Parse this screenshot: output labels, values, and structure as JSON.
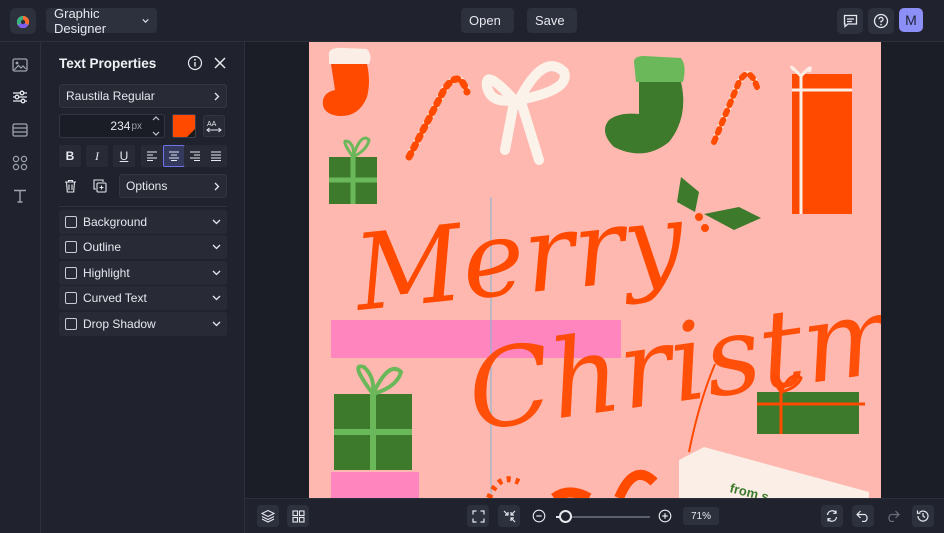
{
  "header": {
    "app_mode": "Graphic Designer",
    "open_label": "Open",
    "save_label": "Save",
    "avatar_initial": "M"
  },
  "sidebar": {
    "items": [
      {
        "name": "image-icon"
      },
      {
        "name": "sliders-icon"
      },
      {
        "name": "layout-icon"
      },
      {
        "name": "graphics-icon"
      },
      {
        "name": "text-icon"
      }
    ]
  },
  "text_panel": {
    "title": "Text Properties",
    "font_name": "Raustila Regular",
    "font_size": "234",
    "font_size_unit": "px",
    "text_color": "#ff4a00",
    "case_label": "AA",
    "options_label": "Options",
    "toggles": [
      {
        "label": "Background",
        "checked": false
      },
      {
        "label": "Outline",
        "checked": false
      },
      {
        "label": "Highlight",
        "checked": false
      },
      {
        "label": "Curved Text",
        "checked": false
      },
      {
        "label": "Drop Shadow",
        "checked": false
      }
    ]
  },
  "canvas": {
    "background_color": "#ffb8b0",
    "greeting_line1": "Merry",
    "greeting_line2": "Christmas",
    "tag_text": "from s",
    "accent_orange": "#ff4a00",
    "accent_green": "#3d7a2b"
  },
  "bottom_bar": {
    "zoom_label": "71%",
    "zoom_value": 0.71
  }
}
